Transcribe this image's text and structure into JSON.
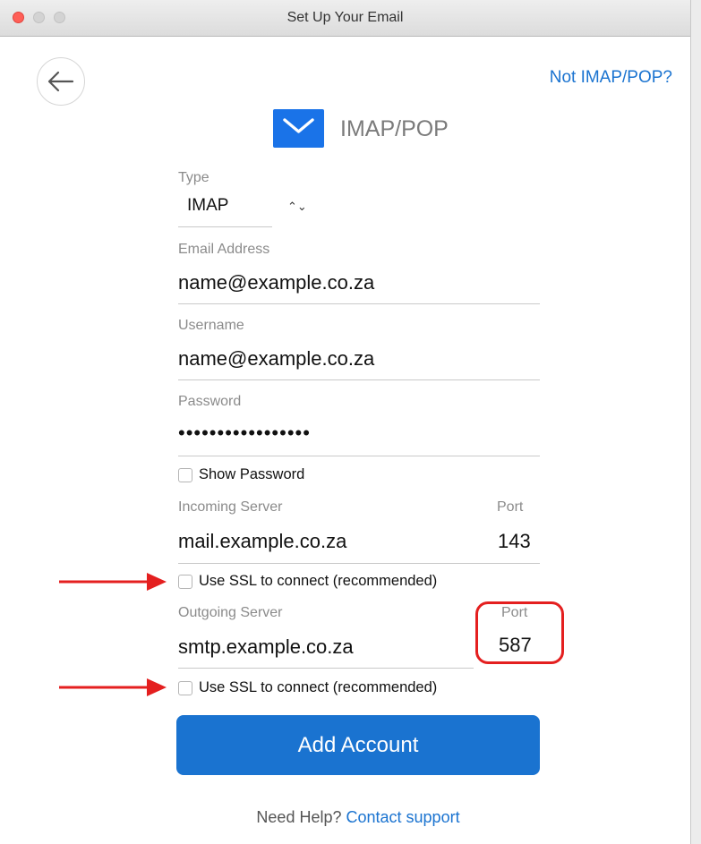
{
  "window": {
    "title": "Set Up Your Email"
  },
  "header": {
    "not_imap_link": "Not IMAP/POP?",
    "account_type_label": "IMAP/POP"
  },
  "form": {
    "type": {
      "label": "Type",
      "value": "IMAP"
    },
    "email": {
      "label": "Email Address",
      "value": "name@example.co.za"
    },
    "username": {
      "label": "Username",
      "value": "name@example.co.za"
    },
    "password": {
      "label": "Password",
      "value": "•••••••••••••••••"
    },
    "show_password": {
      "label": "Show Password",
      "checked": false
    },
    "incoming": {
      "label": "Incoming Server",
      "value": "mail.example.co.za",
      "port_label": "Port",
      "port_value": "143",
      "ssl_label": "Use SSL to connect (recommended)",
      "ssl_checked": false
    },
    "outgoing": {
      "label": "Outgoing Server",
      "value": "smtp.example.co.za",
      "port_label": "Port",
      "port_value": "587",
      "ssl_label": "Use SSL to connect (recommended)",
      "ssl_checked": false
    },
    "add_button": "Add Account"
  },
  "footer": {
    "help_text": "Need Help?",
    "contact_link": "Contact support"
  },
  "colors": {
    "accent": "#1a73d0",
    "annotation": "#e41f1f"
  },
  "icons": {
    "back": "arrow-left-icon",
    "mail": "envelope-icon",
    "select": "chevron-updown-icon"
  }
}
